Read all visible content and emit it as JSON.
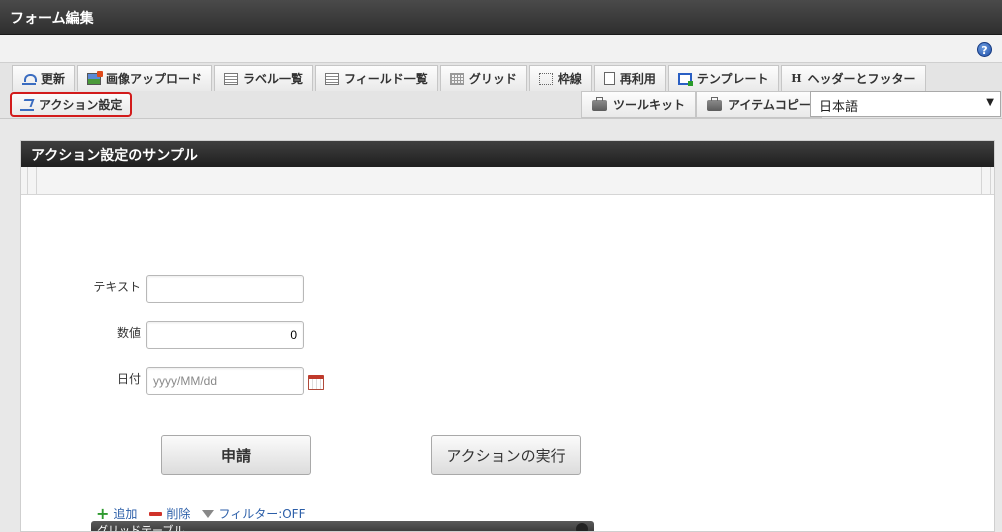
{
  "window": {
    "title": "フォーム編集"
  },
  "toolbar": {
    "tabs": [
      {
        "label": "更新",
        "icon": "refresh-icon"
      },
      {
        "label": "画像アップロード",
        "icon": "image-upload-icon"
      },
      {
        "label": "ラベル一覧",
        "icon": "label-list-icon"
      },
      {
        "label": "フィールド一覧",
        "icon": "field-list-icon"
      },
      {
        "label": "グリッド",
        "icon": "grid-icon"
      },
      {
        "label": "枠線",
        "icon": "border-icon"
      },
      {
        "label": "再利用",
        "icon": "reuse-icon"
      },
      {
        "label": "テンプレート",
        "icon": "template-icon"
      },
      {
        "label": "ヘッダーとフッター",
        "icon": "header-footer-icon"
      }
    ],
    "action_setting": {
      "label": "アクション設定",
      "icon": "action-icon"
    },
    "right_tabs": [
      {
        "label": "ツールキット",
        "icon": "toolkit-icon"
      },
      {
        "label": "アイテムコピー",
        "icon": "toolkit-icon"
      }
    ],
    "language": {
      "selected": "日本語"
    }
  },
  "panel": {
    "title": "アクション設定のサンプル",
    "fields": {
      "text": {
        "label": "テキスト",
        "value": ""
      },
      "number": {
        "label": "数値",
        "value": "0"
      },
      "date": {
        "label": "日付",
        "placeholder": "yyyy/MM/dd"
      }
    },
    "buttons": {
      "apply": "申請",
      "run_action": "アクションの実行"
    },
    "grid_actions": {
      "add": "追加",
      "delete": "削除",
      "filter": "フィルター:OFF"
    },
    "grid_title": "グリッドテーブル"
  },
  "colors": {
    "title_bar": "#2f2f2f",
    "highlight": "#d21b1b",
    "link": "#2b5ea8"
  }
}
